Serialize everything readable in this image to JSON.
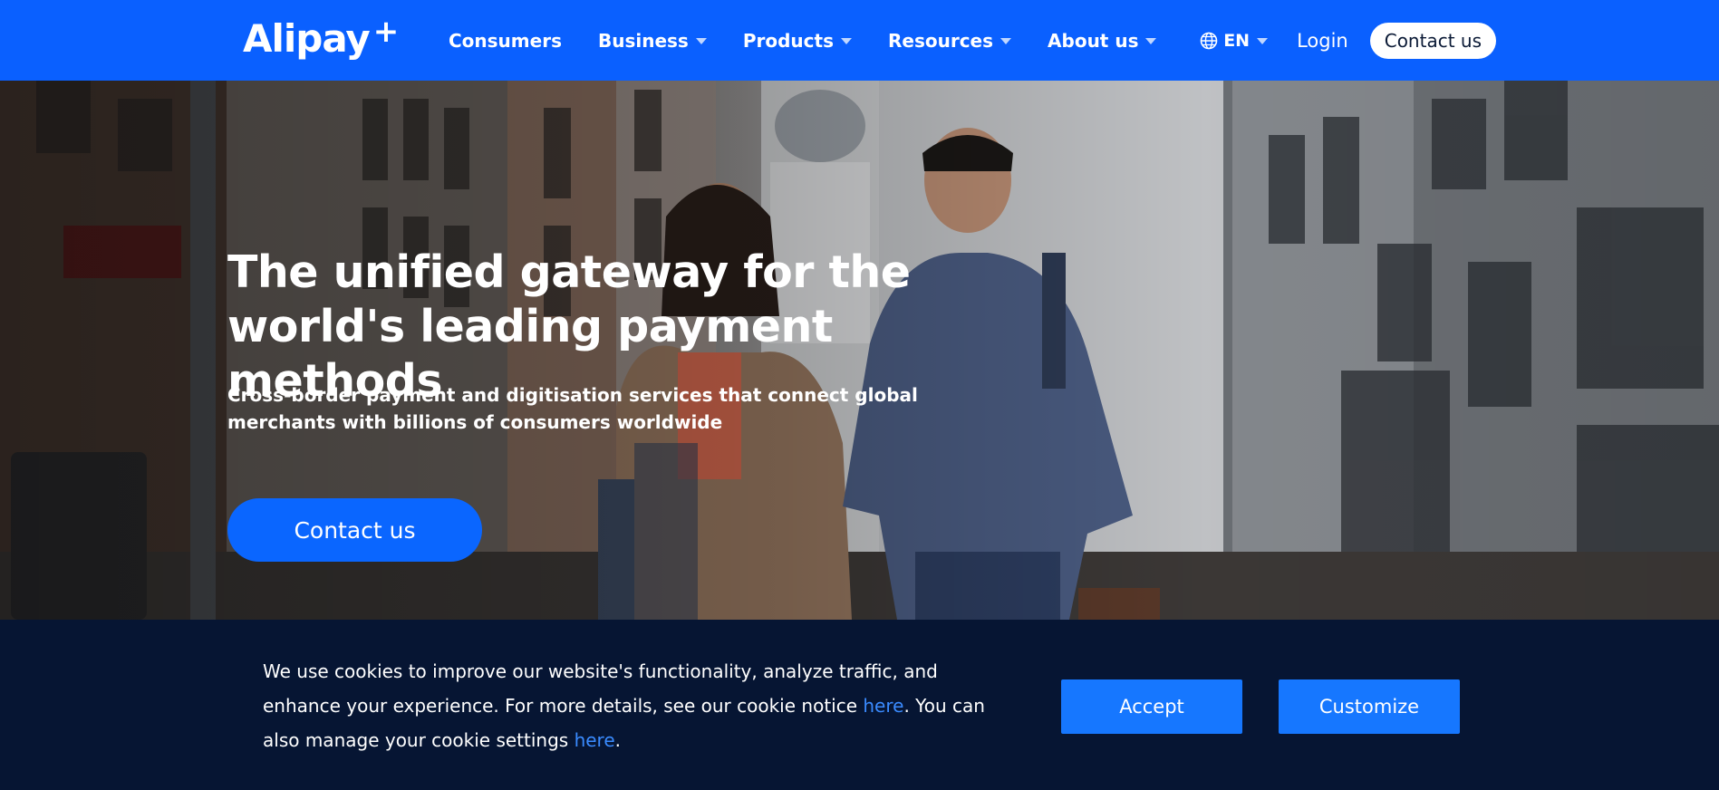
{
  "brand": {
    "logo_text": "Alipay",
    "logo_plus": "+"
  },
  "nav": {
    "items": [
      {
        "label": "Consumers",
        "has_dropdown": false
      },
      {
        "label": "Business",
        "has_dropdown": true
      },
      {
        "label": "Products",
        "has_dropdown": true
      },
      {
        "label": "Resources",
        "has_dropdown": true
      },
      {
        "label": "About us",
        "has_dropdown": true
      }
    ],
    "language": "EN",
    "login": "Login",
    "contact": "Contact us"
  },
  "hero": {
    "title": "The unified gateway for the world's leading payment methods",
    "subtitle": "Cross-border payment and digitisation services that connect global merchants with billions of consumers worldwide",
    "cta": "Contact us"
  },
  "cookie": {
    "text_1": "We use cookies to improve our website's functionality, analyze traffic, and enhance your experience. For more details, see our cookie notice ",
    "link_1": "here",
    "text_2": ". You can also manage your cookie settings ",
    "link_2": "here",
    "text_3": ".",
    "accept": "Accept",
    "customize": "Customize"
  },
  "colors": {
    "nav_bg": "#0a60ff",
    "cta_blue": "#0a66ff",
    "cookie_bg": "#061533",
    "cookie_button": "#1677ff",
    "link": "#3a8bff"
  }
}
